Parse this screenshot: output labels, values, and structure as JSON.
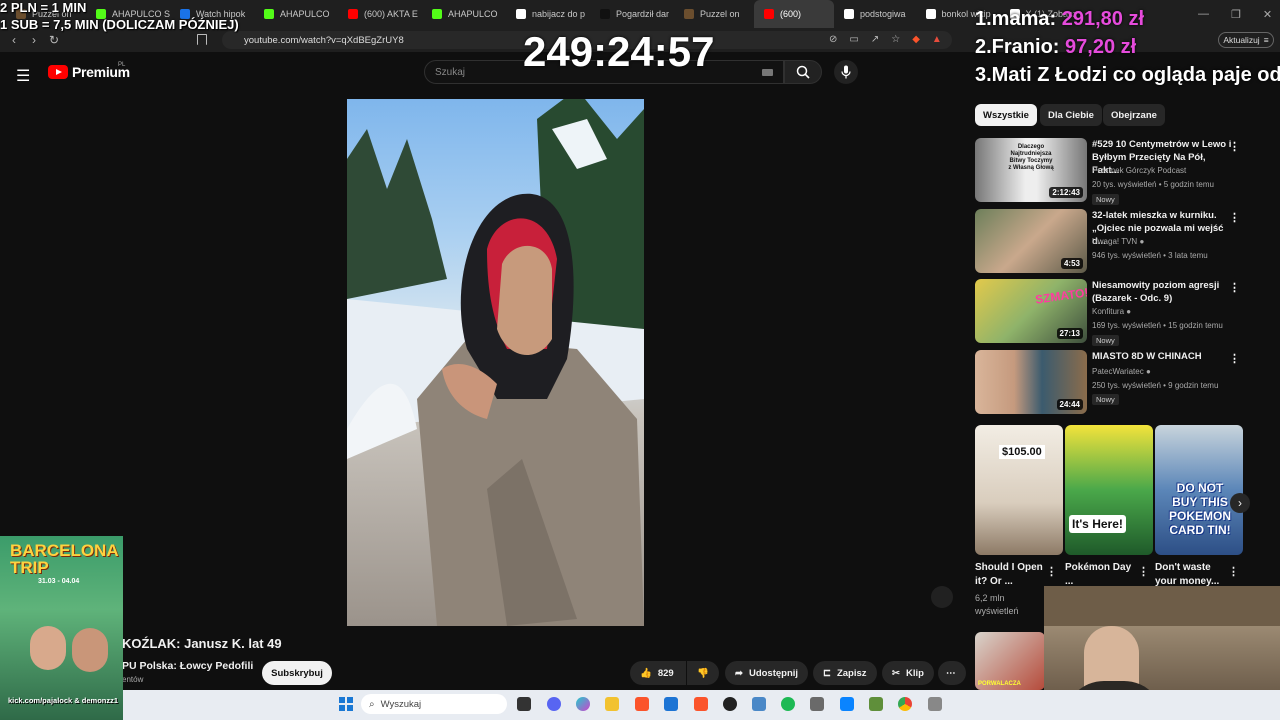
{
  "overlay": {
    "rate_line1": "2 PLN = 1 MIN",
    "rate_line2": "1 SUB = 7,5 MIN (DOLICZAM PÓŹNIEJ)",
    "timer": "249:24:57",
    "donors": [
      {
        "rank_name": "1.mama:",
        "amount": "291,80 zł"
      },
      {
        "rank_name": "2.Franio:",
        "amount": "97,20 zł"
      },
      {
        "rank_name": "3.Mati Z Łodzi co ogląda paje od",
        "amount": ""
      }
    ]
  },
  "browser": {
    "tabs": [
      {
        "label": "Puzzel on",
        "color": "#6b4e2e"
      },
      {
        "label": "AHAPULCO S",
        "color": "#53fc18"
      },
      {
        "label": "Watch hipok",
        "color": "#1a73e8"
      },
      {
        "label": "AHAPULCO",
        "color": "#53fc18"
      },
      {
        "label": "(600) AKTA E",
        "color": "#ff0000"
      },
      {
        "label": "AHAPULCO",
        "color": "#53fc18"
      },
      {
        "label": "nabijacz do p",
        "color": "#ffffff"
      },
      {
        "label": "Pogardził dar",
        "color": "#111111"
      },
      {
        "label": "Puzzel on",
        "color": "#6b4e2e"
      },
      {
        "label": "(600)",
        "color": "#ff0000",
        "active": true
      },
      {
        "label": "podstogiwa",
        "color": "#ffffff"
      },
      {
        "label": "bonkol wikip",
        "color": "#ffffff"
      },
      {
        "label": "X (1) Zobacz",
        "color": "#ffffff"
      }
    ],
    "url": "youtube.com/watch?v=qXdBEgZrUY8",
    "update_button": "Aktualizuj"
  },
  "youtube": {
    "logo_text": "Premium",
    "region": "PL",
    "search_placeholder": "Szukaj",
    "chips": [
      "Wszystkie",
      "Dla Ciebie",
      "Obejrzane"
    ],
    "video_title": "KOŹLAK: Janusz K. lat 49",
    "channel": "PU Polska: Łowcy Pedofili",
    "subscribers": "entów",
    "subscribe_label": "Subskrybuj",
    "likes": "829",
    "share_label": "Udostępnij",
    "save_label": "Zapisz",
    "clip_label": "Klip",
    "recommendations": [
      {
        "title": "#529 10 Centymetrów w Lewo i Byłbym Przecięty Na Pół, Fakt...",
        "channel": "Przemek Górczyk Podcast",
        "meta": "20 tys. wyświetleń • 5 godzin temu",
        "badge": "Nowy",
        "duration": "2:12:43",
        "thumb_caption": "Dlaczego Najtrudniejsza Bitwy Toczymy z Własną Głową"
      },
      {
        "title": "32-latek mieszka w kurniku. „Ojciec nie pozwala mi wejść d...",
        "channel": "Uwaga! TVN",
        "meta": "946 tys. wyświetleń • 3 lata temu",
        "badge": "",
        "duration": "4:53",
        "thumb_caption": ""
      },
      {
        "title": "Niesamowity poziom agresji (Bazarek - Odc. 9)",
        "channel": "Konfitura",
        "meta": "169 tys. wyświetleń • 15 godzin temu",
        "badge": "Nowy",
        "duration": "27:13",
        "thumb_caption": "SZMATO!"
      },
      {
        "title": "MIASTO 8D W CHINACH",
        "channel": "PatecWariatec",
        "meta": "250 tys. wyświetleń • 9 godzin temu",
        "badge": "Nowy",
        "duration": "24:44",
        "thumb_caption": ""
      }
    ],
    "shorts": [
      {
        "title": "Should I Open it? Or ...",
        "views": "6,2 mln wyświetleń",
        "caption": "$105.00"
      },
      {
        "title": "Pokémon Day ...",
        "views": "",
        "caption": "It's Here!"
      },
      {
        "title": "Don't waste your money...",
        "views": "",
        "caption": "DO NOT BUY THIS POKEMON CARD TIN!"
      }
    ],
    "last_thumb_caption": "PORWALACZA"
  },
  "promo": {
    "title": "BARCELONA TRIP",
    "dates": "31.03 - 04.04",
    "handles": "kick.com/pajalock & demonzz1"
  },
  "taskbar": {
    "search_placeholder": "Wyszukaj"
  }
}
